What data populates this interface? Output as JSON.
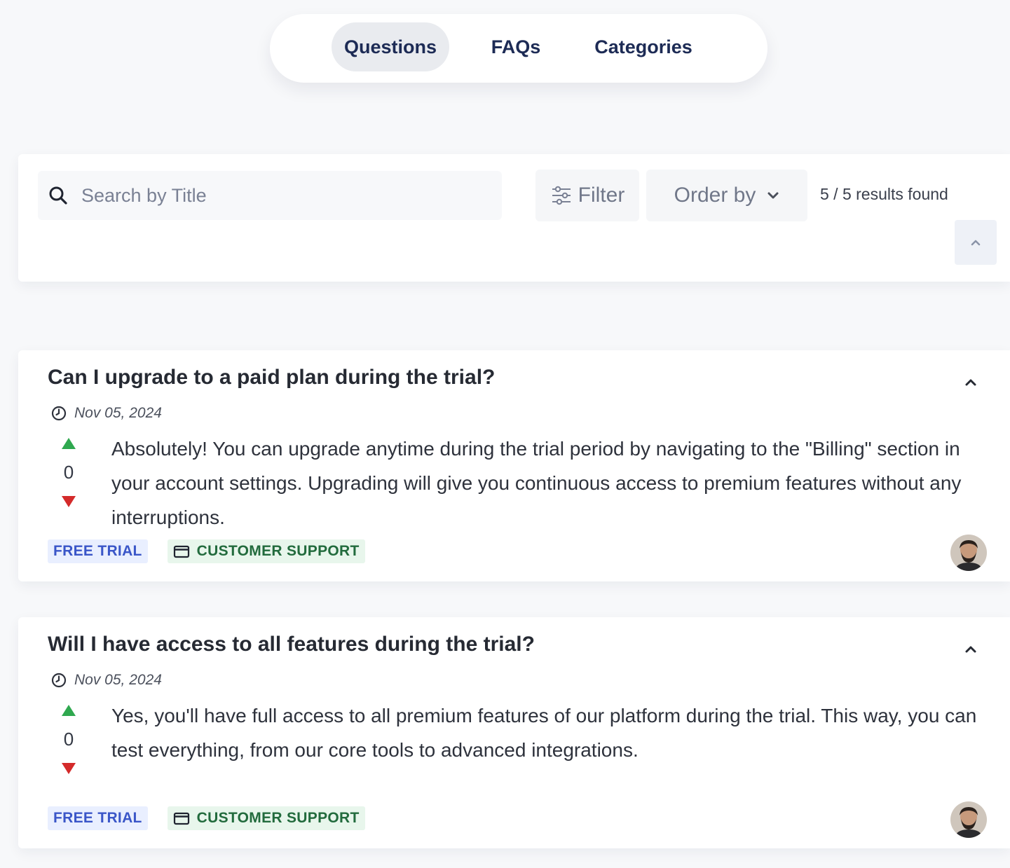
{
  "tabs": [
    {
      "label": "Questions",
      "active": true
    },
    {
      "label": "FAQs",
      "active": false
    },
    {
      "label": "Categories",
      "active": false
    }
  ],
  "search": {
    "placeholder": "Search by Title",
    "value": "",
    "icon": "search-icon"
  },
  "toolbar": {
    "filter_label": "Filter",
    "filter_icon": "sliders-icon",
    "order_label": "Order by",
    "order_icon": "chevron-down-icon",
    "results_text": "5 / 5 results found",
    "collapse_icon": "chevron-up-icon"
  },
  "questions": [
    {
      "title": "Can I upgrade to a paid plan during the trial?",
      "date": "Nov 05, 2024",
      "votes": "0",
      "body": "Absolutely! You can upgrade anytime during the trial period by navigating to the \"Billing\" section in your account settings. Upgrading will give you continuous access to premium features without any interruptions.",
      "tags": [
        "FREE TRIAL"
      ],
      "category": "CUSTOMER SUPPORT"
    },
    {
      "title": "Will I have access to all features during the trial?",
      "date": "Nov 05, 2024",
      "votes": "0",
      "body": "Yes, you'll have full access to all premium features of our platform during the trial. This way, you can test everything, from our core tools to advanced integrations.",
      "tags": [
        "FREE TRIAL"
      ],
      "category": "CUSTOMER SUPPORT"
    }
  ],
  "colors": {
    "vote_up": "#2fa84f",
    "vote_down": "#d42a2a",
    "tag_trial_text": "#3a56c8",
    "tag_support_text": "#226b3d",
    "tab_text": "#1d2b55"
  }
}
